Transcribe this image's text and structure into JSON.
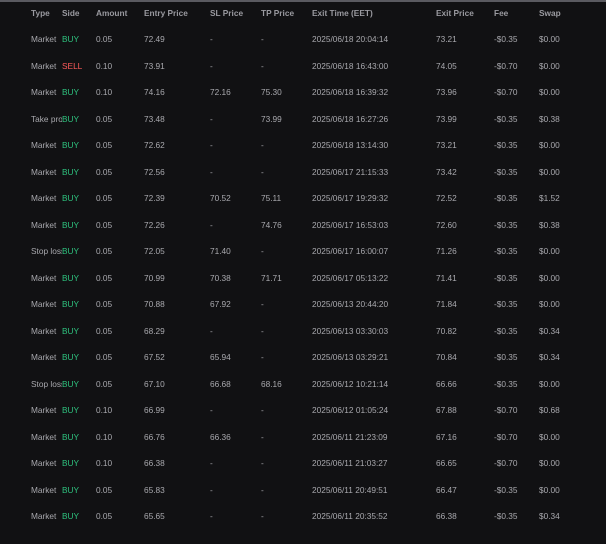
{
  "columns": {
    "type": "Type",
    "side": "Side",
    "amount": "Amount",
    "entry_price": "Entry Price",
    "sl_price": "SL Price",
    "tp_price": "TP Price",
    "exit_time": "Exit Time (EET)",
    "exit_price": "Exit Price",
    "fee": "Fee",
    "swap": "Swap"
  },
  "colors": {
    "buy": "#2ec27e",
    "sell": "#ff5a5a",
    "background": "#111113"
  },
  "rows": [
    [
      "Market",
      "BUY",
      "0.05",
      "72.49",
      "-",
      "-",
      "2025/06/18 20:04:14",
      "73.21",
      "-$0.35",
      "$0.00"
    ],
    [
      "Market",
      "SELL",
      "0.10",
      "73.91",
      "-",
      "-",
      "2025/06/18 16:43:00",
      "74.05",
      "-$0.70",
      "$0.00"
    ],
    [
      "Market",
      "BUY",
      "0.10",
      "74.16",
      "72.16",
      "75.30",
      "2025/06/18 16:39:32",
      "73.96",
      "-$0.70",
      "$0.00"
    ],
    [
      "Take profit",
      "BUY",
      "0.05",
      "73.48",
      "-",
      "73.99",
      "2025/06/18 16:27:26",
      "73.99",
      "-$0.35",
      "$0.38"
    ],
    [
      "Market",
      "BUY",
      "0.05",
      "72.62",
      "-",
      "-",
      "2025/06/18 13:14:30",
      "73.21",
      "-$0.35",
      "$0.00"
    ],
    [
      "Market",
      "BUY",
      "0.05",
      "72.56",
      "-",
      "-",
      "2025/06/17 21:15:33",
      "73.42",
      "-$0.35",
      "$0.00"
    ],
    [
      "Market",
      "BUY",
      "0.05",
      "72.39",
      "70.52",
      "75.11",
      "2025/06/17 19:29:32",
      "72.52",
      "-$0.35",
      "$1.52"
    ],
    [
      "Market",
      "BUY",
      "0.05",
      "72.26",
      "-",
      "74.76",
      "2025/06/17 16:53:03",
      "72.60",
      "-$0.35",
      "$0.38"
    ],
    [
      "Stop loss",
      "BUY",
      "0.05",
      "72.05",
      "71.40",
      "-",
      "2025/06/17 16:00:07",
      "71.26",
      "-$0.35",
      "$0.00"
    ],
    [
      "Market",
      "BUY",
      "0.05",
      "70.99",
      "70.38",
      "71.71",
      "2025/06/17 05:13:22",
      "71.41",
      "-$0.35",
      "$0.00"
    ],
    [
      "Market",
      "BUY",
      "0.05",
      "70.88",
      "67.92",
      "-",
      "2025/06/13 20:44:20",
      "71.84",
      "-$0.35",
      "$0.00"
    ],
    [
      "Market",
      "BUY",
      "0.05",
      "68.29",
      "-",
      "-",
      "2025/06/13 03:30:03",
      "70.82",
      "-$0.35",
      "$0.34"
    ],
    [
      "Market",
      "BUY",
      "0.05",
      "67.52",
      "65.94",
      "-",
      "2025/06/13 03:29:21",
      "70.84",
      "-$0.35",
      "$0.34"
    ],
    [
      "Stop loss",
      "BUY",
      "0.05",
      "67.10",
      "66.68",
      "68.16",
      "2025/06/12 10:21:14",
      "66.66",
      "-$0.35",
      "$0.00"
    ],
    [
      "Market",
      "BUY",
      "0.10",
      "66.99",
      "-",
      "-",
      "2025/06/12 01:05:24",
      "67.88",
      "-$0.70",
      "$0.68"
    ],
    [
      "Market",
      "BUY",
      "0.10",
      "66.76",
      "66.36",
      "-",
      "2025/06/11 21:23:09",
      "67.16",
      "-$0.70",
      "$0.00"
    ],
    [
      "Market",
      "BUY",
      "0.10",
      "66.38",
      "-",
      "-",
      "2025/06/11 21:03:27",
      "66.65",
      "-$0.70",
      "$0.00"
    ],
    [
      "Market",
      "BUY",
      "0.05",
      "65.83",
      "-",
      "-",
      "2025/06/11 20:49:51",
      "66.47",
      "-$0.35",
      "$0.00"
    ],
    [
      "Market",
      "BUY",
      "0.05",
      "65.65",
      "-",
      "-",
      "2025/06/11 20:35:52",
      "66.38",
      "-$0.35",
      "$0.34"
    ]
  ]
}
